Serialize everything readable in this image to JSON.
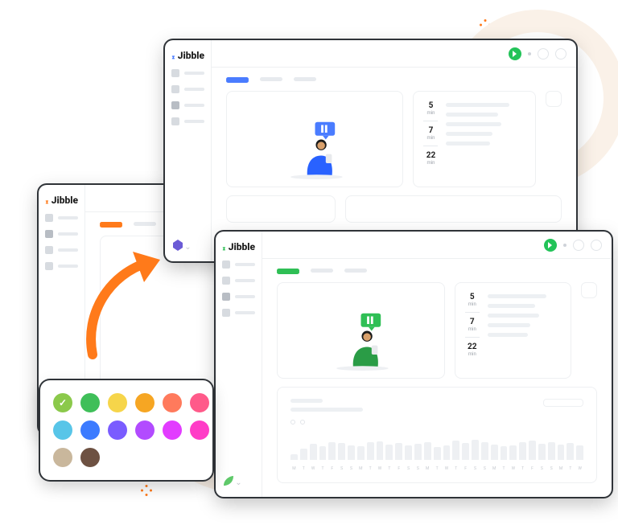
{
  "brand": "Jibble",
  "accent": {
    "blue": "#4a7cff",
    "green": "#2fbf55",
    "orange": "#ff7a1a"
  },
  "windows": {
    "blue": {
      "stats": [
        {
          "n": "5",
          "u": "min"
        },
        {
          "n": "7",
          "u": "min"
        },
        {
          "n": "22",
          "u": "min"
        }
      ]
    },
    "green": {
      "stats": [
        {
          "n": "5",
          "u": "min"
        },
        {
          "n": "7",
          "u": "min"
        },
        {
          "n": "22",
          "u": "min"
        }
      ]
    }
  },
  "chart_data": {
    "type": "bar",
    "categories": [
      "M",
      "T",
      "W",
      "T",
      "F",
      "S",
      "S",
      "M",
      "T",
      "W",
      "T",
      "F",
      "S",
      "S",
      "M",
      "T",
      "W",
      "T",
      "F",
      "S",
      "S",
      "M",
      "T",
      "W",
      "T",
      "F",
      "S",
      "S",
      "M",
      "T",
      "W"
    ],
    "values": [
      20,
      40,
      55,
      48,
      62,
      58,
      50,
      46,
      60,
      64,
      52,
      58,
      49,
      55,
      62,
      45,
      50,
      66,
      58,
      70,
      60,
      54,
      48,
      50,
      62,
      66,
      55,
      60,
      52,
      58,
      50
    ],
    "title": "",
    "xlabel": "",
    "ylabel": "",
    "ylim": [
      0,
      100
    ]
  },
  "colors": [
    {
      "hex": "#8bc94b",
      "sel": true
    },
    {
      "hex": "#3fbf59"
    },
    {
      "hex": "#f6d54a"
    },
    {
      "hex": "#f6a623"
    },
    {
      "hex": "#ff7a5c"
    },
    {
      "hex": "#ff5a8a"
    },
    {
      "hex": "#58c5e8"
    },
    {
      "hex": "#3c7bff"
    },
    {
      "hex": "#7a5cff"
    },
    {
      "hex": "#b24bff"
    },
    {
      "hex": "#e23cff"
    },
    {
      "hex": "#ff3cc7"
    },
    {
      "hex": "#c9b79c"
    },
    {
      "hex": "#6d5142"
    }
  ]
}
